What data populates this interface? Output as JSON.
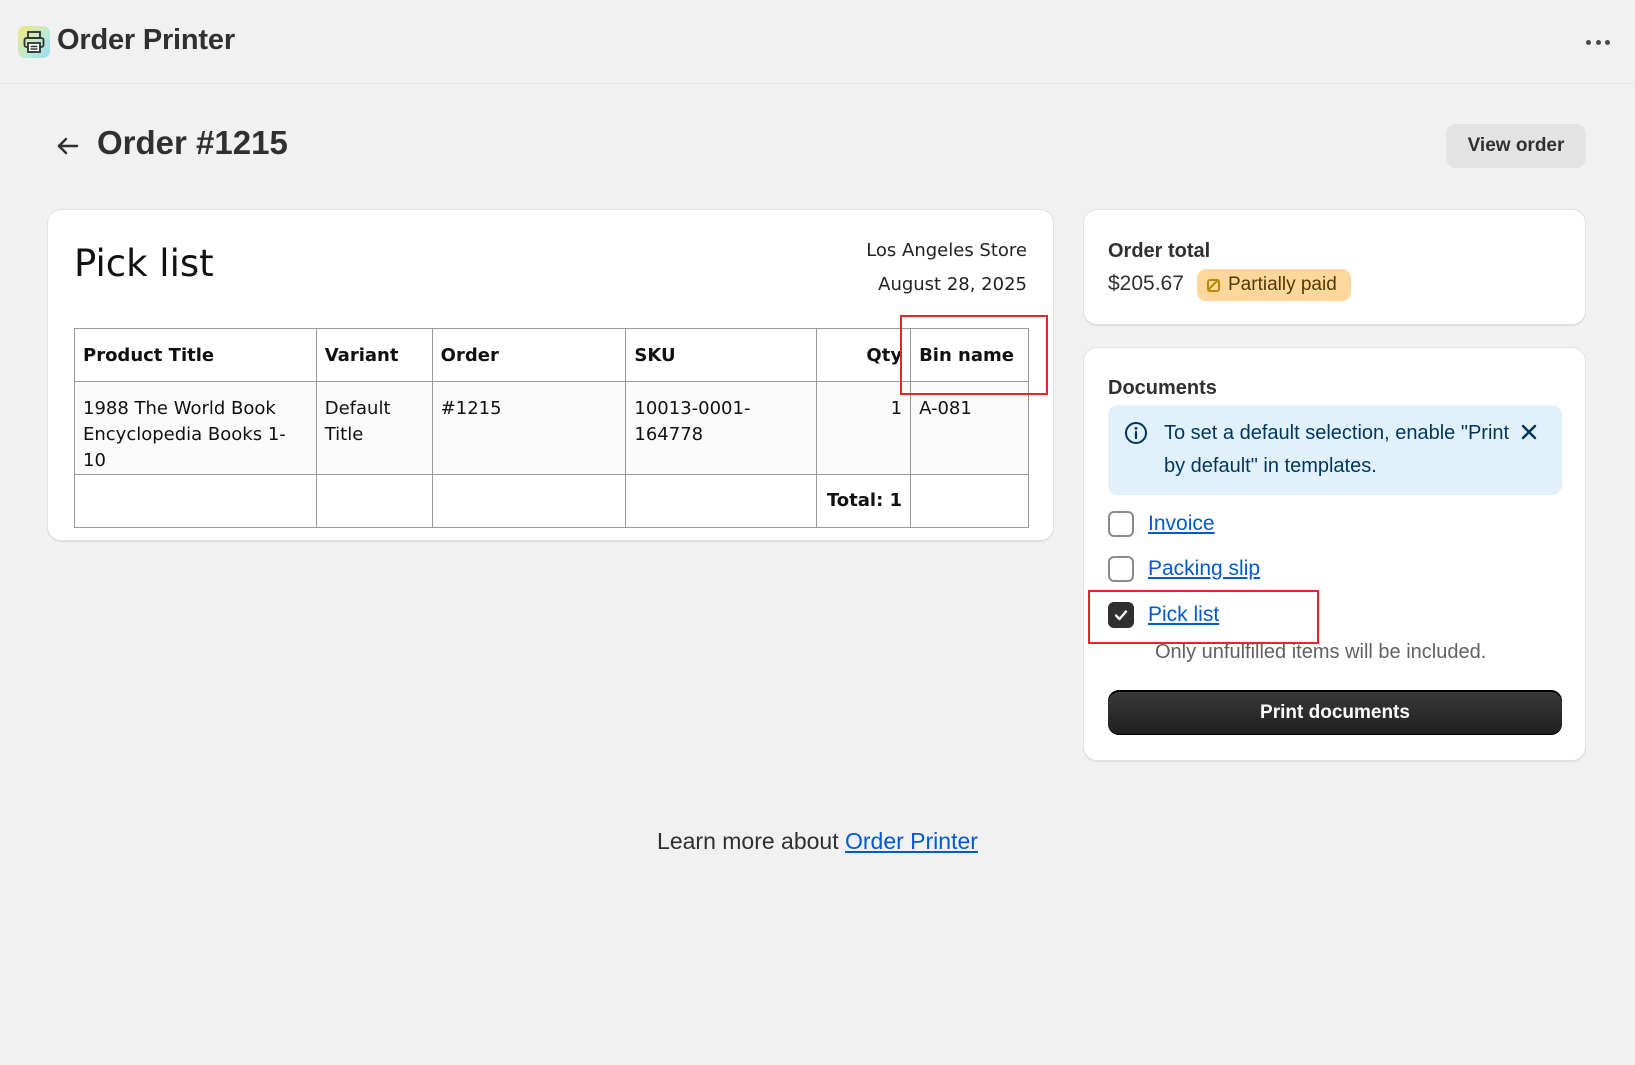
{
  "app": {
    "title": "Order Printer",
    "logo_icon": "printer-icon"
  },
  "header": {
    "title": "Order #1215",
    "view_order_label": "View order"
  },
  "pick_list": {
    "title": "Pick list",
    "store": "Los Angeles Store",
    "date": "August 28, 2025",
    "columns": [
      "Product Title",
      "Variant",
      "Order",
      "SKU",
      "Qty",
      "Bin name"
    ],
    "rows": [
      {
        "product_title": "1988 The World Book Encyclopedia Books 1-10",
        "variant": "Default Title",
        "order": "#1215",
        "sku": "10013-0001-164778",
        "qty": "1",
        "bin_name": "A-081"
      }
    ],
    "total_label": "Total: 1"
  },
  "order_total": {
    "label": "Order total",
    "amount": "$205.67",
    "status": "Partially paid",
    "status_color": "#ffd79d"
  },
  "documents": {
    "label": "Documents",
    "banner_text": "To set a default selection, enable \"Print by default\" in templates.",
    "items": [
      {
        "label": "Invoice",
        "checked": false
      },
      {
        "label": "Packing slip",
        "checked": false
      },
      {
        "label": "Pick list",
        "checked": true
      }
    ],
    "note": "Only unfulfilled items will be included.",
    "print_label": "Print documents"
  },
  "footer": {
    "text": "Learn more about ",
    "link": "Order Printer"
  },
  "colors": {
    "link": "#005bd3",
    "highlight": "#e2262a",
    "banner": "#e0f1fb"
  }
}
